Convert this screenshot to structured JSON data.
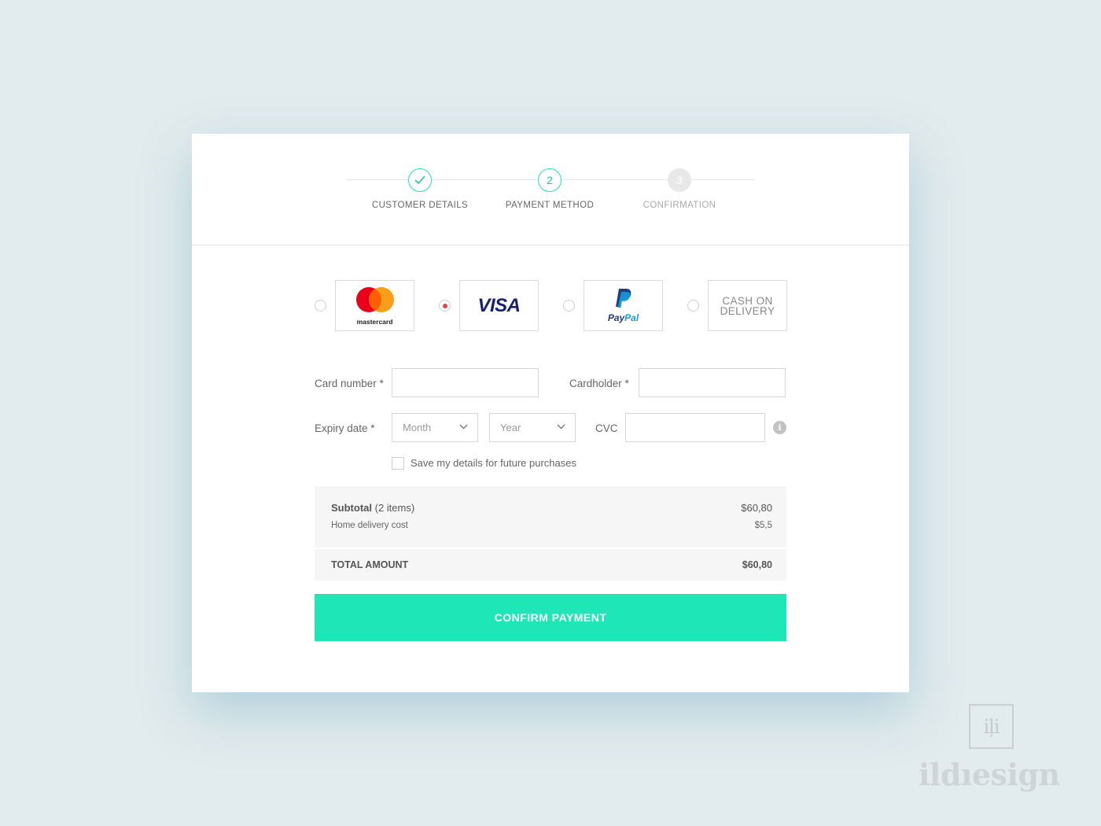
{
  "stepper": {
    "steps": [
      {
        "label": "CUSTOMER DETAILS",
        "marker": "check-icon",
        "state": "done"
      },
      {
        "label": "PAYMENT METHOD",
        "marker": "2",
        "state": "active"
      },
      {
        "label": "CONFIRMATION",
        "marker": "3",
        "state": "todo"
      }
    ],
    "accent_color": "#1ee6b6"
  },
  "payment_methods": {
    "selected": "visa",
    "options": [
      {
        "id": "mastercard",
        "logo": "mastercard-logo",
        "logo_text": "mastercard",
        "checked": false
      },
      {
        "id": "visa",
        "logo": "visa-logo",
        "logo_text": "VISA",
        "checked": true
      },
      {
        "id": "paypal",
        "logo": "paypal-logo",
        "logo_text_1": "Pay",
        "logo_text_2": "Pal",
        "checked": false
      },
      {
        "id": "cash",
        "label_line1": "CASH ON",
        "label_line2": "DELIVERY",
        "checked": false
      }
    ]
  },
  "form": {
    "card_number_label": "Card number *",
    "card_number_value": "",
    "cardholder_label": "Cardholder *",
    "cardholder_value": "",
    "expiry_label": "Expiry date *",
    "month_placeholder": "Month",
    "year_placeholder": "Year",
    "cvc_label": "CVC",
    "cvc_value": "",
    "cvc_info": "i",
    "save_details_label": "Save my details for future purchases",
    "save_details_checked": false
  },
  "summary": {
    "subtotal_label": "Subtotal",
    "subtotal_items": "(2 items)",
    "subtotal_value": "$60,80",
    "delivery_label": "Home delivery cost",
    "delivery_value": "$5,5",
    "total_label": "TOTAL AMOUNT",
    "total_value": "$60,80"
  },
  "confirm_button": {
    "label": "CONFIRM PAYMENT",
    "color": "#1ee6b6"
  },
  "watermark": {
    "monogram": "iļi",
    "text": "ildıesign"
  }
}
